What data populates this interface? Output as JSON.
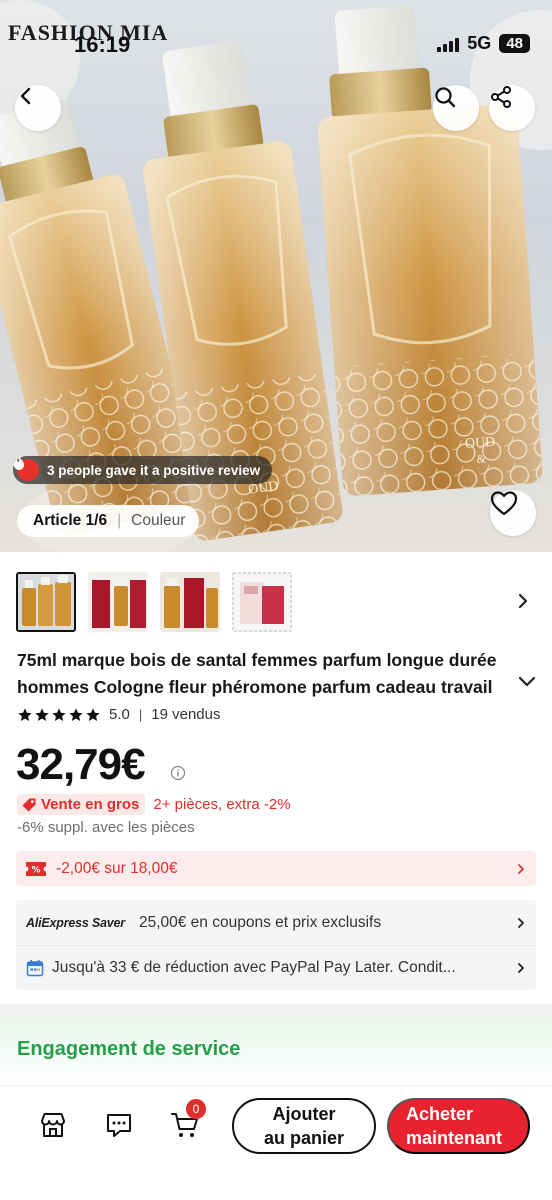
{
  "status_bar": {
    "time": "16:19",
    "network": "5G",
    "battery": "48"
  },
  "hero": {
    "watermark": "FASHION MIA",
    "review_banner": "3 people gave it a positive review",
    "article_label": "Article 1/6",
    "variant_label": "Couleur"
  },
  "thumbnails": {
    "count": 4,
    "selected_index": 0
  },
  "product": {
    "title": "75ml marque bois de santal femmes parfum longue durée hommes Cologne fleur phéromone parfum cadeau travail",
    "rating": "5.0",
    "sold": "19 vendus",
    "price": "32,79€"
  },
  "promotions": {
    "bulk_badge": "Vente en gros",
    "bulk_text": "2+ pièces, extra -2%",
    "extra_discount": "-6% suppl. avec les pièces",
    "coupon": "-2,00€ sur 18,00€",
    "saver_logo": "AliExpress Saver",
    "saver_text": "25,00€ en coupons et prix exclusifs",
    "paypal_text": "Jusqu'à 33 € de réduction avec PayPal Pay Later. Condit..."
  },
  "service": {
    "title": "Engagement de service"
  },
  "bottom_bar": {
    "cart_count": "0",
    "add_to_cart_line1": "Ajouter",
    "add_to_cart_line2": "au panier",
    "buy_now_line1": "Acheter",
    "buy_now_line2": "maintenant"
  },
  "colors": {
    "accent_red": "#e8232f",
    "service_green": "#2a9d4a",
    "coupon_bg": "#fdeced"
  },
  "icons": [
    "back-arrow-icon",
    "search-icon",
    "share-icon",
    "heart-icon",
    "fire-icon",
    "chevron-right-icon",
    "chevron-down-icon",
    "star-icon",
    "info-icon",
    "tag-icon",
    "coupon-icon",
    "calendar-icon",
    "store-icon",
    "chat-icon",
    "cart-icon"
  ]
}
